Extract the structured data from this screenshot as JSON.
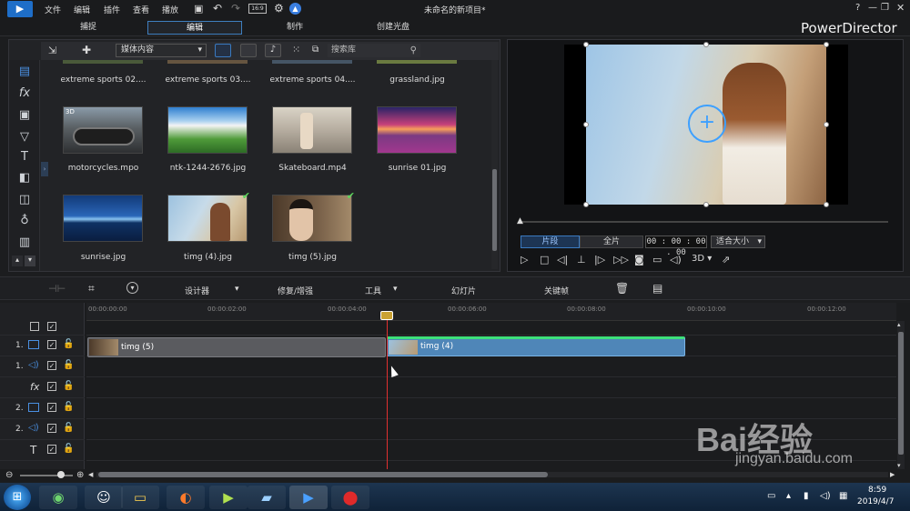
{
  "window": {
    "title": "未命名的新项目*",
    "brand": "PowerDirector"
  },
  "menu": [
    {
      "label": "文件"
    },
    {
      "label": "编辑"
    },
    {
      "label": "插件"
    },
    {
      "label": "查看"
    },
    {
      "label": "播放"
    }
  ],
  "modes": [
    {
      "label": "捕捉"
    },
    {
      "label": "编辑"
    },
    {
      "label": "制作"
    },
    {
      "label": "创建光盘"
    }
  ],
  "library": {
    "dropdown": "媒体内容",
    "search_placeholder": "搜索库",
    "top_row": [
      {
        "name": "extreme sports 02...."
      },
      {
        "name": "extreme sports 03...."
      },
      {
        "name": "extreme sports 04...."
      },
      {
        "name": "grassland.jpg"
      }
    ],
    "items": [
      {
        "name": "motorcycles.mpo",
        "badge": "3D"
      },
      {
        "name": "ntk-1244-2676.jpg"
      },
      {
        "name": "Skateboard.mp4"
      },
      {
        "name": "sunrise 01.jpg"
      },
      {
        "name": "sunrise.jpg"
      },
      {
        "name": "timg (4).jpg"
      },
      {
        "name": "timg (5).jpg"
      }
    ]
  },
  "preview": {
    "seg_clip": "片段",
    "seg_full": "全片",
    "timecode": "00 : 00 : 00 . 00",
    "zoom": "适合大小",
    "mode_3d": "3D"
  },
  "edit_toolbar": {
    "designer": "设计器",
    "fix": "修复/增强",
    "tools": "工具",
    "slideshow": "幻灯片",
    "keyframe": "关键帧"
  },
  "ruler": [
    "00:00:00:00",
    "00:00:02:00",
    "00:00:04:00",
    "00:00:06:00",
    "00:00:08:00",
    "00:00:10:00",
    "00:00:12:00"
  ],
  "tracks": [
    {
      "num": "",
      "icon": ""
    },
    {
      "num": "1.",
      "icon": "video"
    },
    {
      "num": "1.",
      "icon": "audio"
    },
    {
      "num": "",
      "icon": "fx"
    },
    {
      "num": "2.",
      "icon": "video"
    },
    {
      "num": "2.",
      "icon": "audio"
    },
    {
      "num": "",
      "icon": "T"
    },
    {
      "num": "",
      "icon": "mic"
    }
  ],
  "clips": [
    {
      "label": "timg (5)"
    },
    {
      "label": "timg (4)"
    }
  ],
  "taskbar": {
    "time": "8:59",
    "date": "2019/4/7"
  },
  "watermark": {
    "brand": "Bai经验",
    "url": "jingyan.baidu.com"
  }
}
